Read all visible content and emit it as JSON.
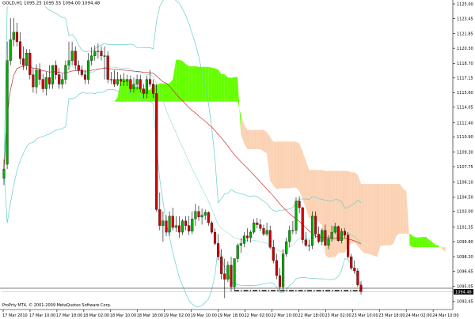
{
  "chart_data": {
    "type": "candlestick",
    "title": "GOLD,H1 1095.25 1095.55 1094.00 1094.48",
    "symbol": "GOLD,H1",
    "ohlc_header": [
      "1095.25",
      "1095.55",
      "1094.00",
      "1094.48"
    ],
    "ylim": [
      1092.6,
      1125.0
    ],
    "y_ticks": [
      "1125.00",
      "1123.45",
      "1121.85",
      "1120.30",
      "1118.70",
      "1117.15",
      "1115.60",
      "1114.05",
      "1112.40",
      "1110.90",
      "1109.30",
      "1107.75",
      "1106.10",
      "1104.50",
      "1103.00",
      "1101.35",
      "1099.80",
      "1098.20",
      "1096.65",
      "1095.05",
      "1093.45"
    ],
    "y_tick_values": [
      1125.0,
      1123.45,
      1121.85,
      1120.3,
      1118.7,
      1117.15,
      1115.6,
      1114.05,
      1112.4,
      1110.9,
      1109.3,
      1107.75,
      1106.1,
      1104.5,
      1103.0,
      1101.35,
      1099.8,
      1098.2,
      1096.65,
      1095.05,
      1093.45
    ],
    "x_ticks": [
      "17 Mar 2010",
      "17 Mar 10:00",
      "17 Mar 18:00",
      "18 Mar 02:00",
      "18 Mar 10:00",
      "18 Mar 18:00",
      "19 Mar 02:00",
      "19 Mar 10:00",
      "19 Mar 18:00",
      "22 Mar 02:00",
      "22 Mar 10:00",
      "22 Mar 18:00",
      "23 Mar 02:00",
      "23 Mar 10:00",
      "23 Mar 18:00",
      "24 Mar 02:00",
      "24 Mar 10:00"
    ],
    "current_price_label": "1094.48",
    "copyright": "ProPrty MT4, © 2001-2009 MetaQuotes Software Corp.",
    "series": [
      {
        "kind": "ohlc",
        "note": "Hourly GOLD bars, approximated from the image",
        "open": [
          1106.5,
          1108.0,
          1119.0,
          1121.2,
          1122.0,
          1121.0,
          1119.2,
          1118.5,
          1119.8,
          1117.5,
          1116.2,
          1118.0,
          1117.0,
          1116.0,
          1117.2,
          1116.5,
          1118.5,
          1117.5,
          1116.5,
          1117.0,
          1118.5,
          1119.0,
          1120.0,
          1118.5,
          1118.0,
          1117.5,
          1117.0,
          1119.0,
          1119.5,
          1120.0,
          1120.0,
          1119.5,
          1119.5,
          1117.0,
          1117.0,
          1116.5,
          1117.0,
          1116.8,
          1116.8,
          1117.0,
          1116.0,
          1116.5,
          1117.0,
          1116.0,
          1115.5,
          1117.0,
          1116.5,
          1115.5,
          1103.2,
          1101.5,
          1102.0,
          1100.8,
          1102.5,
          1101.3,
          1101.5,
          1100.8,
          1102.0,
          1101.5,
          1100.9,
          1102.2,
          1103.0,
          1102.4,
          1102.6,
          1102.9,
          1101.8,
          1100.8,
          1099.6,
          1098.2,
          1096.4,
          1095.8,
          1097.3,
          1095.0,
          1098.0,
          1099.4,
          1099.6,
          1100.4,
          1100.2,
          1100.8,
          1101.8,
          1101.6,
          1101.2,
          1100.6,
          1101.0,
          1099.2,
          1097.8,
          1096.2,
          1095.0,
          1098.5,
          1099.8,
          1101.0,
          1101.0,
          1104.1,
          1103.4,
          1100.0,
          1099.4,
          1099.4,
          1102.5,
          1100.6,
          1099.8,
          1101.0,
          1099.4,
          1100.1,
          1100.8,
          1101.4,
          1099.9,
          1100.9,
          1100.5,
          1098.2,
          1097.0,
          1096.7,
          1095.2
        ],
        "high": [
          1108.5,
          1121.0,
          1123.5,
          1123.5,
          1123.0,
          1122.0,
          1120.5,
          1120.2,
          1120.2,
          1118.2,
          1118.6,
          1118.7,
          1117.6,
          1117.8,
          1118.5,
          1118.5,
          1119.0,
          1118.2,
          1117.6,
          1119.0,
          1121.0,
          1121.0,
          1120.5,
          1119.0,
          1118.5,
          1118.0,
          1119.8,
          1120.4,
          1120.6,
          1120.8,
          1120.5,
          1120.5,
          1120.0,
          1117.8,
          1118.0,
          1117.8,
          1117.5,
          1117.7,
          1117.5,
          1117.4,
          1117.2,
          1117.5,
          1117.5,
          1116.5,
          1117.4,
          1118.0,
          1117.0,
          1116.5,
          1105.0,
          1103.0,
          1102.6,
          1103.0,
          1103.4,
          1102.5,
          1102.5,
          1102.2,
          1102.5,
          1102.5,
          1103.0,
          1103.8,
          1103.6,
          1103.3,
          1103.2,
          1103.0,
          1102.0,
          1101.2,
          1100.6,
          1099.0,
          1098.0,
          1097.7,
          1098.2,
          1097.0,
          1099.6,
          1100.2,
          1100.8,
          1101.2,
          1101.0,
          1102.2,
          1102.3,
          1102.2,
          1101.6,
          1101.8,
          1101.5,
          1100.0,
          1098.5,
          1097.0,
          1099.0,
          1100.2,
          1101.5,
          1102.0,
          1104.5,
          1104.6,
          1103.5,
          1100.8,
          1100.0,
          1103.0,
          1103.0,
          1101.4,
          1101.2,
          1101.6,
          1100.5,
          1101.5,
          1101.8,
          1101.5,
          1101.2,
          1101.2,
          1100.8,
          1098.5,
          1097.8,
          1097.0,
          1095.6
        ],
        "low": [
          1105.8,
          1107.5,
          1118.5,
          1120.5,
          1120.5,
          1118.6,
          1118.0,
          1118.0,
          1117.0,
          1115.6,
          1115.5,
          1116.4,
          1115.6,
          1115.3,
          1116.0,
          1116.0,
          1117.0,
          1116.0,
          1116.0,
          1116.5,
          1118.0,
          1118.5,
          1118.0,
          1117.5,
          1117.3,
          1116.5,
          1116.5,
          1118.5,
          1119.0,
          1119.2,
          1119.0,
          1117.0,
          1116.6,
          1116.5,
          1116.2,
          1116.3,
          1116.3,
          1116.3,
          1116.3,
          1115.6,
          1115.6,
          1115.9,
          1115.6,
          1115.0,
          1115.0,
          1116.2,
          1115.0,
          1103.0,
          1101.0,
          1099.8,
          1100.4,
          1100.4,
          1101.0,
          1100.8,
          1100.2,
          1100.5,
          1101.0,
          1100.5,
          1100.6,
          1101.5,
          1102.0,
          1101.6,
          1102.1,
          1101.5,
          1100.6,
          1099.4,
          1097.8,
          1095.8,
          1093.8,
          1095.5,
          1094.5,
          1094.6,
          1097.6,
          1098.6,
          1099.2,
          1099.8,
          1099.7,
          1100.6,
          1101.2,
          1100.9,
          1100.4,
          1100.4,
          1099.0,
          1097.5,
          1095.8,
          1094.6,
          1094.6,
          1098.2,
          1099.2,
          1100.6,
          1100.6,
          1102.8,
          1099.6,
          1099.2,
          1098.8,
          1099.0,
          1100.2,
          1099.6,
          1099.4,
          1099.4,
          1099.0,
          1099.8,
          1100.6,
          1099.8,
          1099.6,
          1100.2,
          1098.0,
          1096.8,
          1096.4,
          1095.0,
          1094.2
        ],
        "close": [
          1107.5,
          1119.0,
          1121.2,
          1122.0,
          1121.0,
          1119.2,
          1118.5,
          1119.8,
          1117.5,
          1116.2,
          1118.0,
          1117.0,
          1116.0,
          1117.2,
          1116.5,
          1118.5,
          1117.5,
          1116.5,
          1117.0,
          1118.5,
          1119.0,
          1120.0,
          1118.5,
          1118.0,
          1117.5,
          1117.0,
          1119.0,
          1119.5,
          1120.0,
          1120.0,
          1119.5,
          1119.5,
          1117.0,
          1117.0,
          1116.5,
          1117.0,
          1116.8,
          1116.8,
          1117.0,
          1116.0,
          1116.5,
          1117.0,
          1116.0,
          1115.5,
          1117.0,
          1116.5,
          1115.5,
          1103.2,
          1101.5,
          1102.0,
          1100.8,
          1102.5,
          1101.3,
          1101.5,
          1100.8,
          1102.0,
          1101.5,
          1100.9,
          1102.2,
          1103.0,
          1102.4,
          1102.6,
          1102.9,
          1101.8,
          1100.8,
          1099.6,
          1098.2,
          1096.4,
          1095.8,
          1097.3,
          1095.0,
          1098.0,
          1099.4,
          1099.6,
          1100.4,
          1100.2,
          1100.8,
          1101.8,
          1101.6,
          1101.2,
          1100.6,
          1101.0,
          1099.2,
          1097.8,
          1096.2,
          1095.0,
          1098.5,
          1099.8,
          1101.0,
          1101.0,
          1104.1,
          1103.4,
          1100.0,
          1099.4,
          1099.4,
          1102.5,
          1100.6,
          1099.8,
          1101.0,
          1099.4,
          1100.1,
          1100.8,
          1101.4,
          1099.9,
          1100.9,
          1100.5,
          1098.2,
          1097.0,
          1096.7,
          1095.2,
          1094.48
        ]
      }
    ],
    "indicators": [
      "Ichimoku cloud",
      "Bollinger Bands",
      "Moving average (red)"
    ],
    "support_line_value": 1094.6,
    "colors": {
      "background": "#ffffff",
      "bull_candle": "#00aa00",
      "bear_candle": "#cc0000",
      "cloud_green": "#66ff00",
      "cloud_peach": "#fbd3b4",
      "bollinger": "#66cccc",
      "moving_average": "#cc3333",
      "support_line": "#000000",
      "grid": "#cccccc"
    }
  }
}
